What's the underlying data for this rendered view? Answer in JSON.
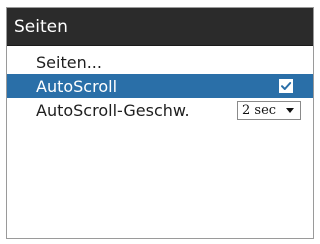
{
  "window": {
    "title": "Seiten"
  },
  "menu": {
    "items": [
      {
        "label": "Seiten..."
      },
      {
        "label": "AutoScroll",
        "checked": true,
        "selected": true
      },
      {
        "label": "AutoScroll-Geschw.",
        "value": "2 sec"
      }
    ]
  },
  "icons": {
    "checkbox_checked": "check-icon",
    "dropdown": "chevron-down-icon"
  },
  "colors": {
    "titlebar": "#2b2b2b",
    "selection": "#2a6fa8"
  }
}
